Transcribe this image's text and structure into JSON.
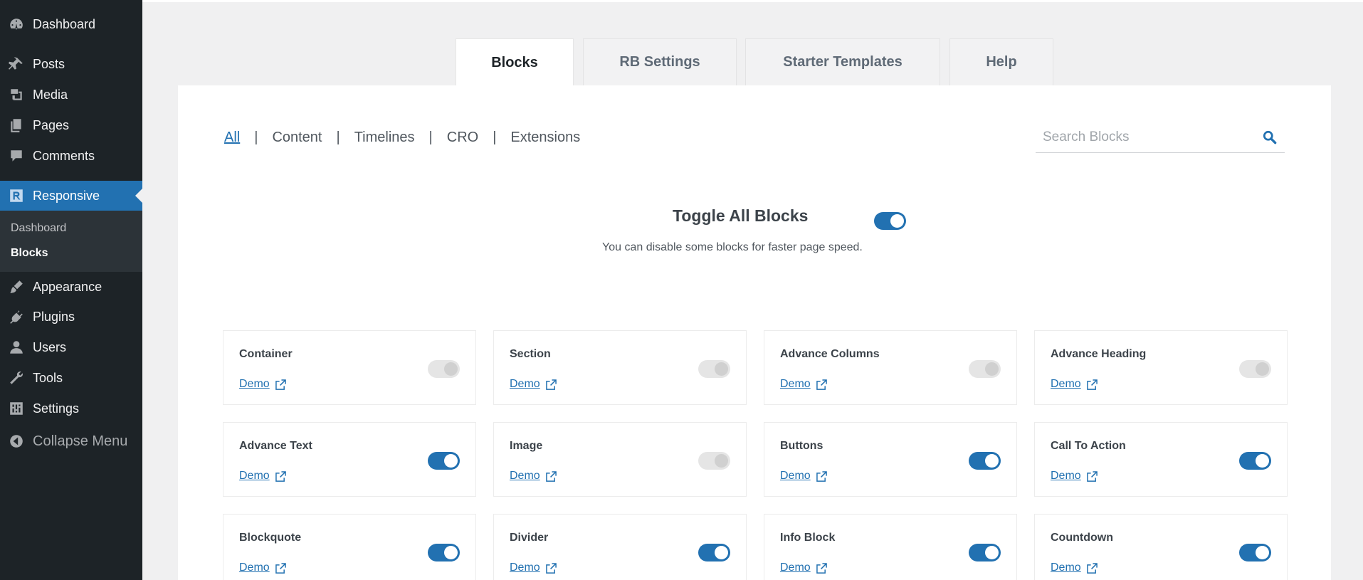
{
  "sidebar": {
    "items": [
      {
        "label": "Dashboard",
        "icon": "dashboard-icon"
      },
      {
        "label": "Posts",
        "icon": "pin-icon"
      },
      {
        "label": "Media",
        "icon": "media-icon"
      },
      {
        "label": "Pages",
        "icon": "pages-icon"
      },
      {
        "label": "Comments",
        "icon": "comment-icon"
      },
      {
        "label": "Responsive",
        "icon": "responsive-logo-icon"
      },
      {
        "label": "Appearance",
        "icon": "brush-icon"
      },
      {
        "label": "Plugins",
        "icon": "plugin-icon"
      },
      {
        "label": "Users",
        "icon": "user-icon"
      },
      {
        "label": "Tools",
        "icon": "wrench-icon"
      },
      {
        "label": "Settings",
        "icon": "settings-icon"
      },
      {
        "label": "Collapse Menu",
        "icon": "collapse-icon"
      }
    ],
    "submenu": [
      "Dashboard",
      "Blocks"
    ]
  },
  "tabs": [
    "Blocks",
    "RB Settings",
    "Starter Templates",
    "Help"
  ],
  "filters": [
    "All",
    "Content",
    "Timelines",
    "CRO",
    "Extensions"
  ],
  "search": {
    "placeholder": "Search Blocks"
  },
  "toggle_all": {
    "title": "Toggle All Blocks",
    "description": "You can disable some blocks for faster page speed.",
    "enabled": true
  },
  "demo_label": "Demo",
  "blocks": [
    {
      "name": "Container",
      "enabled": false
    },
    {
      "name": "Section",
      "enabled": false
    },
    {
      "name": "Advance Columns",
      "enabled": false
    },
    {
      "name": "Advance Heading",
      "enabled": false
    },
    {
      "name": "Advance Text",
      "enabled": true
    },
    {
      "name": "Image",
      "enabled": false
    },
    {
      "name": "Buttons",
      "enabled": true
    },
    {
      "name": "Call To Action",
      "enabled": true
    },
    {
      "name": "Blockquote",
      "enabled": true
    },
    {
      "name": "Divider",
      "enabled": true
    },
    {
      "name": "Info Block",
      "enabled": true
    },
    {
      "name": "Countdown",
      "enabled": true
    }
  ],
  "colors": {
    "accent": "#2271b1",
    "sidebar": "#1d2327"
  }
}
